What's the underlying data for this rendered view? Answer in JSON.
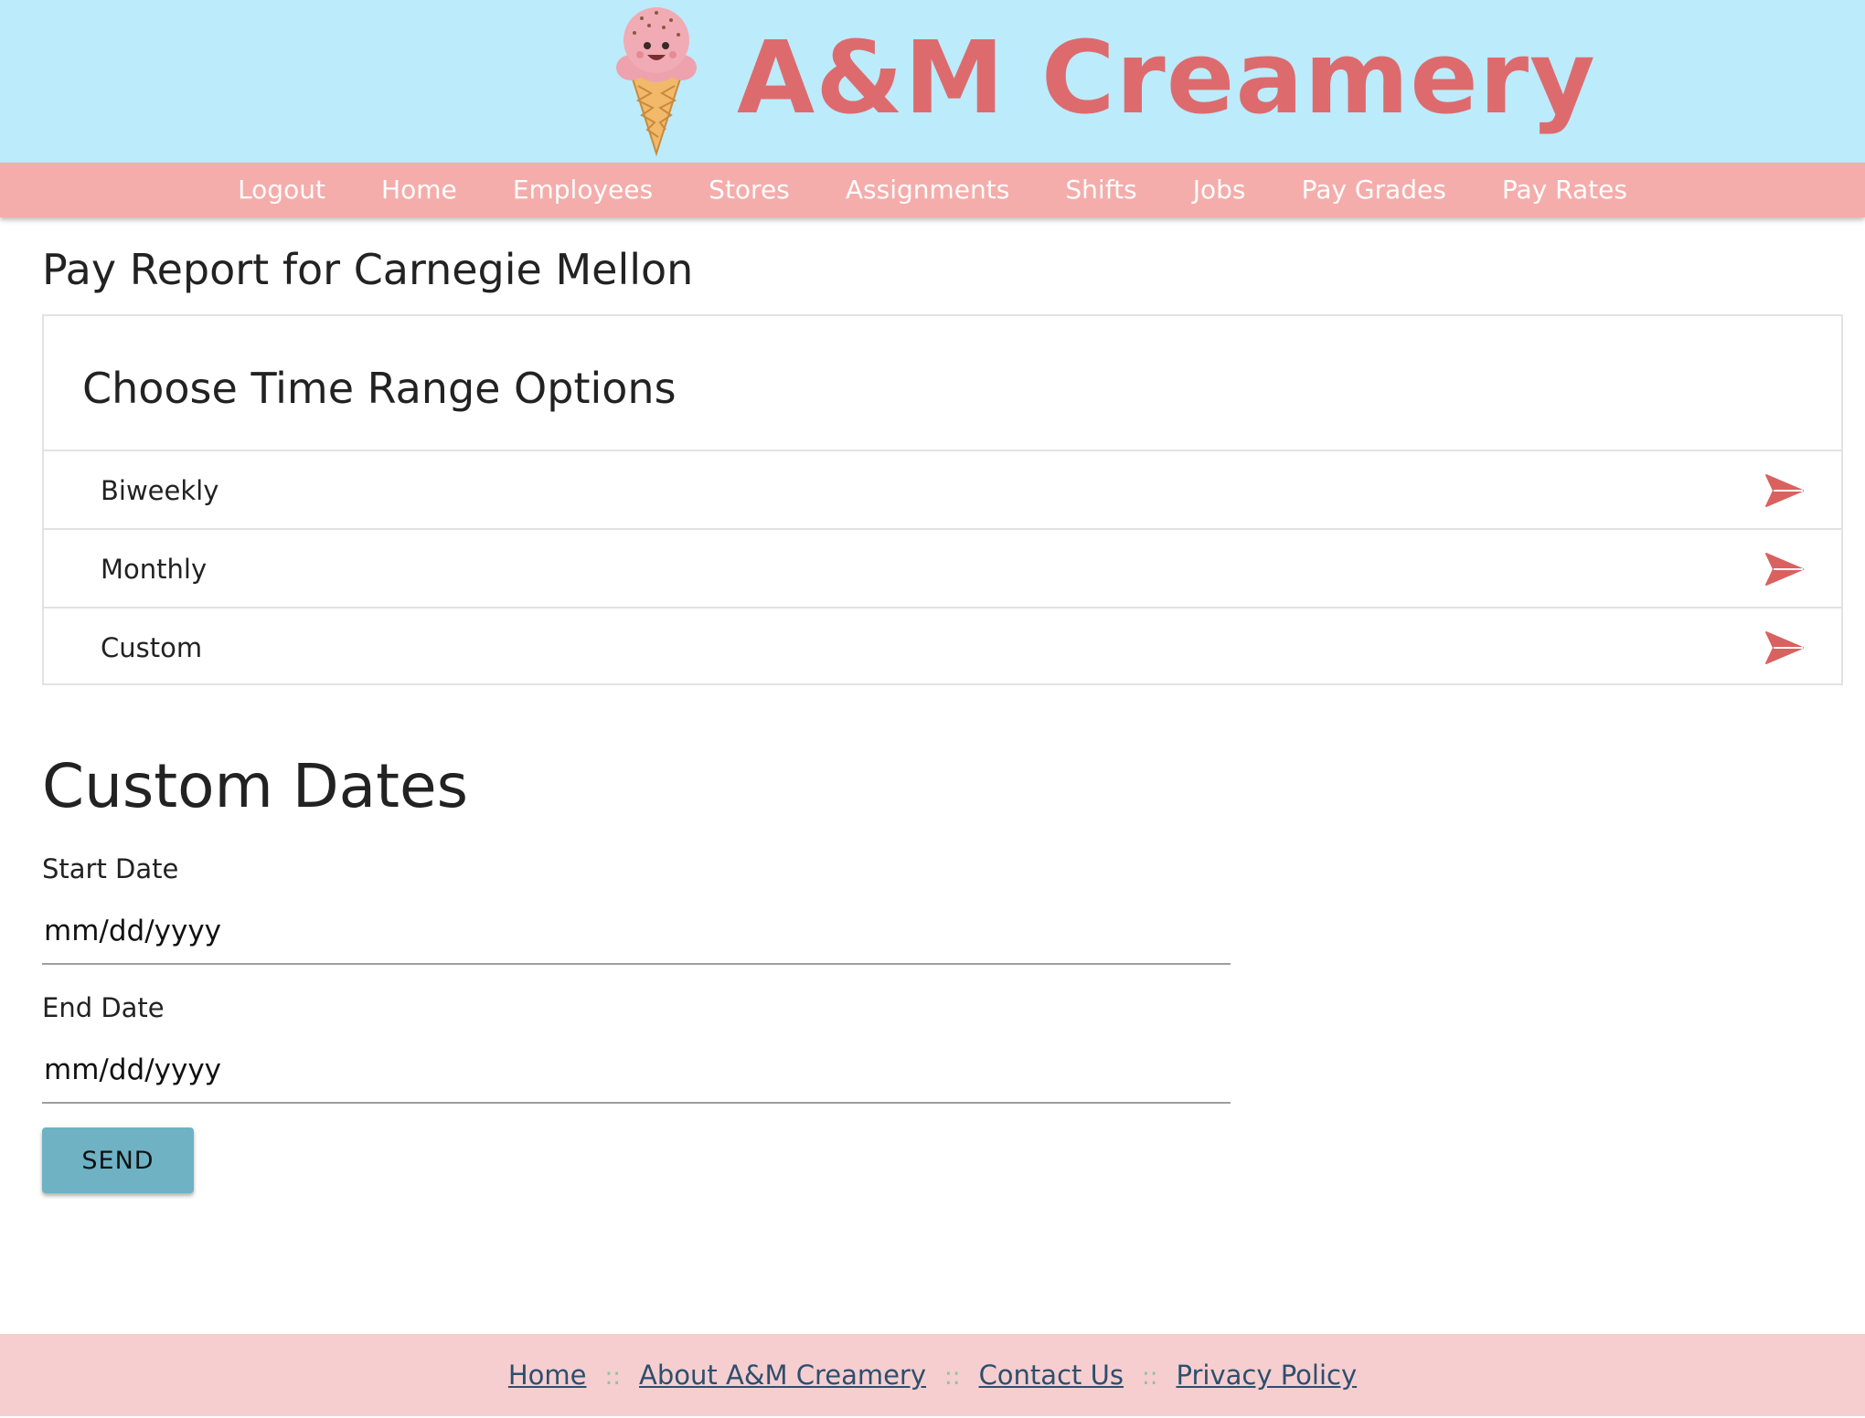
{
  "header": {
    "site_title": "A&M Creamery",
    "logo_icon": "ice-cream-cone-icon",
    "colors": {
      "header_bg": "#bcebfb",
      "title": "#dd6b6e"
    }
  },
  "nav": {
    "items": [
      {
        "label": "Logout"
      },
      {
        "label": "Home"
      },
      {
        "label": "Employees"
      },
      {
        "label": "Stores"
      },
      {
        "label": "Assignments"
      },
      {
        "label": "Shifts"
      },
      {
        "label": "Jobs"
      },
      {
        "label": "Pay Grades"
      },
      {
        "label": "Pay Rates"
      }
    ],
    "bg_color": "#f4adab"
  },
  "main": {
    "page_title": "Pay Report for Carnegie Mellon",
    "panel": {
      "title": "Choose Time Range Options",
      "options": [
        {
          "label": "Biweekly",
          "icon": "send-arrow-icon"
        },
        {
          "label": "Monthly",
          "icon": "send-arrow-icon"
        },
        {
          "label": "Custom",
          "icon": "send-arrow-icon"
        }
      ],
      "icon_color": "#d9615f"
    },
    "custom_dates": {
      "title": "Custom Dates",
      "start_label": "Start Date",
      "start_placeholder": "mm/dd/yyyy",
      "end_label": "End Date",
      "end_placeholder": "mm/dd/yyyy",
      "send_label": "SEND",
      "send_color": "#6eb2c4"
    }
  },
  "footer": {
    "links": [
      {
        "label": "Home"
      },
      {
        "label": "About A&M Creamery"
      },
      {
        "label": "Contact Us"
      },
      {
        "label": "Privacy Policy"
      }
    ],
    "separator": "::",
    "bg_color": "#f6cecf"
  }
}
